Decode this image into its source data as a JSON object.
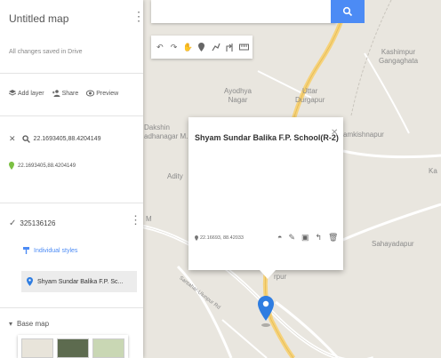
{
  "colors": {
    "accent": "#4c8bf5",
    "marker": "#2f7de1",
    "road": "#f6d27a"
  },
  "map": {
    "labels": [
      {
        "id": "kashimpur",
        "text": "Kashimpur\nGangaghata"
      },
      {
        "id": "ayodhya",
        "text": "Ayodhya\nNagar"
      },
      {
        "id": "uttar",
        "text": "Uttar\nDurgapur"
      },
      {
        "id": "dakshin",
        "text": "Dakshin\nadhanagar M."
      },
      {
        "id": "kamkishnapur",
        "text": "amkishnapur"
      },
      {
        "id": "adityapur",
        "text": "Adity"
      },
      {
        "id": "sahayadapur",
        "text": "Sahayadapur"
      },
      {
        "id": "road",
        "text": "Santahar-Ulunpur Rd"
      },
      {
        "id": "m",
        "text": "M"
      },
      {
        "id": "ka",
        "text": "Ka"
      },
      {
        "id": "pur",
        "text": "rpur"
      }
    ]
  },
  "search": {
    "placeholder": ""
  },
  "panel": {
    "title": "Untitled map",
    "saved": "All changes saved in Drive",
    "actions": {
      "add_layer": "Add layer",
      "share": "Share",
      "preview": "Preview"
    },
    "search_layer": {
      "query": "22.1693405,88.4204149",
      "result": "22.1693405,88.4204149"
    },
    "layer": {
      "name": "325136126",
      "styles": "Individual styles",
      "item": "Shyam Sundar Balika F.P. Sc..."
    },
    "basemap": "Base map"
  },
  "popup": {
    "title": "Shyam Sundar Balika F.P. School(R-2)",
    "coords": "22.16693, 88.42033"
  }
}
